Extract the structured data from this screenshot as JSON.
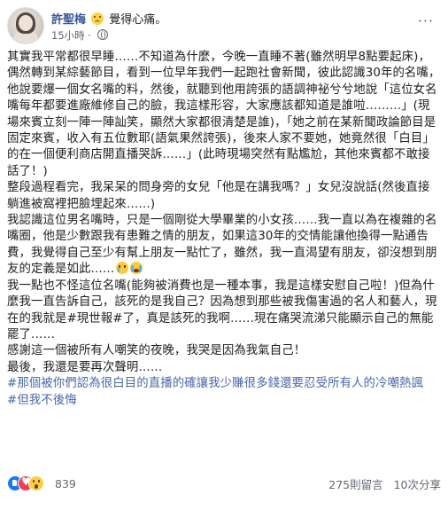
{
  "post": {
    "author": "許聖梅",
    "feeling": "覺得心痛。",
    "time": "15小時",
    "privacy_separator": "·"
  },
  "content": {
    "paragraphs": [
      "其實我平常都很早睡……不知道為什麼，今晚一直睡不著(雖然明早8點要起床)，偶然轉到某綜藝節目，看到一位早年我們一起跑社會新聞，彼此認識30年的名嘴，他說要爆一個女名嘴的料，然後，就聽到他用誇張的語調神祕兮兮地說「這位女名嘴每年都要進廠維修自己的臉，我這樣形容，大家應該都知道是誰啦………」(現場來賓立刻一陣一陣訕笑，顯然大家都很清楚是誰)，「她之前在某新聞政論節目是固定來賓，收入有五位數耶(語氣果然誇張)，後來人家不要她，她竟然很「白目」的在一個便利商店開直播哭訴……」(此時現場突然有點尷尬，其他來賓都不敢接話了！)",
      "整段過程看完，我呆呆的問身旁的女兒「他是在講我嗎？」女兒沒說話(然後直接躺進被窩裡把臉埋起來……)",
      "我認識這位男名嘴時，只是一個剛從大學畢業的小女孩……我一直以為在複雜的名嘴圈，他是少數跟我有患難之情的朋友，如果這30年的交情能讓他換得一點通告費，我覺得自己至少有幫上朋友一點忙了，雖然，我一直渴望有朋友，卻沒想到朋友的定義是如此……",
      "我一點也不怪這位名嘴(能夠被消費也是一種本事，我是這樣安慰自己啦！)但為什麼我一直告訴自己，該死的是我自己？因為想到那些被我傷害過的名人和藝人，現在的我就是#現世報#了，真是該死的我啊……現在痛哭流涕只能顯示自己的無能罷了……",
      "感謝這一個被所有人嘲笑的夜晚，我哭是因為我氣自己！",
      "最後，我還是要再次聲明……"
    ],
    "hashtag_1": "#那個被你們認為很白目的直播的確讓我少賺很多錢還要忍受所有人的冷嘲熱諷",
    "hashtag_2": "#但我不後悔"
  },
  "footer": {
    "reaction_count": "839",
    "comments": "275則留言",
    "shares": "10次分享"
  }
}
